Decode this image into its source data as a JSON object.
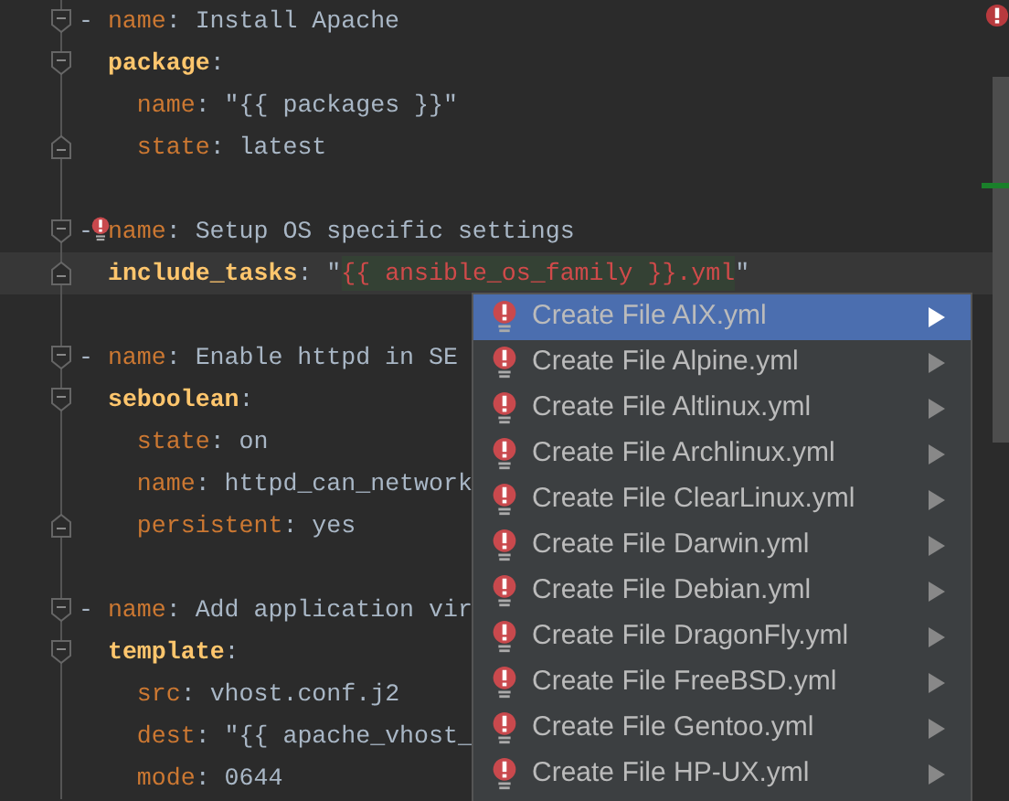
{
  "editor": {
    "lines": [
      {
        "kind": "code",
        "fold_start": true,
        "fold_end": false,
        "error": false,
        "current": false,
        "tokens": [
          {
            "text": "-",
            "kind": "dash"
          },
          {
            "text": "name",
            "kind": "key"
          },
          {
            "text": ":",
            "kind": "colon"
          },
          {
            "text": "Install Apache",
            "kind": "value"
          }
        ]
      },
      {
        "kind": "code",
        "fold_start": true,
        "fold_end": false,
        "error": false,
        "current": false,
        "tokens": [
          {
            "text": "  package",
            "kind": "section"
          },
          {
            "text": ":",
            "kind": "colon"
          }
        ]
      },
      {
        "kind": "code",
        "fold_start": false,
        "fold_end": false,
        "error": false,
        "current": false,
        "tokens": [
          {
            "text": "    name",
            "kind": "key"
          },
          {
            "text": ":",
            "kind": "colon"
          },
          {
            "text": "\"{{ packages }}\"",
            "kind": "value"
          }
        ]
      },
      {
        "kind": "code",
        "fold_start": false,
        "fold_end": true,
        "error": false,
        "current": false,
        "tokens": [
          {
            "text": "    state",
            "kind": "key"
          },
          {
            "text": ":",
            "kind": "colon"
          },
          {
            "text": "latest",
            "kind": "value"
          }
        ]
      },
      {
        "kind": "blank"
      },
      {
        "kind": "code",
        "fold_start": true,
        "fold_end": false,
        "error": true,
        "current": false,
        "tokens": [
          {
            "text": "-",
            "kind": "dash"
          },
          {
            "text": "name",
            "kind": "key"
          },
          {
            "text": ":",
            "kind": "colon"
          },
          {
            "text": "Setup OS specific settings",
            "kind": "value"
          }
        ]
      },
      {
        "kind": "code",
        "fold_start": false,
        "fold_end": true,
        "error": false,
        "current": true,
        "tokens": [
          {
            "text": "  include_tasks",
            "kind": "section"
          },
          {
            "text": ":",
            "kind": "colon"
          },
          {
            "text": "\"",
            "kind": "quote"
          },
          {
            "text": "{{ ansible_os_family }}.yml",
            "kind": "error"
          },
          {
            "text": "\"",
            "kind": "quote"
          }
        ]
      },
      {
        "kind": "blank"
      },
      {
        "kind": "code",
        "fold_start": true,
        "fold_end": false,
        "error": false,
        "current": false,
        "tokens": [
          {
            "text": "-",
            "kind": "dash"
          },
          {
            "text": "name",
            "kind": "key"
          },
          {
            "text": ":",
            "kind": "colon"
          },
          {
            "text": "Enable httpd in SE",
            "kind": "value"
          }
        ]
      },
      {
        "kind": "code",
        "fold_start": true,
        "fold_end": false,
        "error": false,
        "current": false,
        "tokens": [
          {
            "text": "  seboolean",
            "kind": "section"
          },
          {
            "text": ":",
            "kind": "colon"
          }
        ]
      },
      {
        "kind": "code",
        "fold_start": false,
        "fold_end": false,
        "error": false,
        "current": false,
        "tokens": [
          {
            "text": "    state",
            "kind": "key"
          },
          {
            "text": ":",
            "kind": "colon"
          },
          {
            "text": "on",
            "kind": "value"
          }
        ]
      },
      {
        "kind": "code",
        "fold_start": false,
        "fold_end": false,
        "error": false,
        "current": false,
        "tokens": [
          {
            "text": "    name",
            "kind": "key"
          },
          {
            "text": ":",
            "kind": "colon"
          },
          {
            "text": "httpd_can_network",
            "kind": "value"
          }
        ]
      },
      {
        "kind": "code",
        "fold_start": false,
        "fold_end": true,
        "error": false,
        "current": false,
        "tokens": [
          {
            "text": "    persistent",
            "kind": "key"
          },
          {
            "text": ":",
            "kind": "colon"
          },
          {
            "text": "yes",
            "kind": "value"
          }
        ]
      },
      {
        "kind": "blank"
      },
      {
        "kind": "code",
        "fold_start": true,
        "fold_end": false,
        "error": false,
        "current": false,
        "tokens": [
          {
            "text": "-",
            "kind": "dash"
          },
          {
            "text": "name",
            "kind": "key"
          },
          {
            "text": ":",
            "kind": "colon"
          },
          {
            "text": "Add application vir",
            "kind": "value"
          }
        ]
      },
      {
        "kind": "code",
        "fold_start": true,
        "fold_end": false,
        "error": false,
        "current": false,
        "tokens": [
          {
            "text": "  template",
            "kind": "section"
          },
          {
            "text": ":",
            "kind": "colon"
          }
        ]
      },
      {
        "kind": "code",
        "fold_start": false,
        "fold_end": false,
        "error": false,
        "current": false,
        "tokens": [
          {
            "text": "    src",
            "kind": "key"
          },
          {
            "text": ":",
            "kind": "colon"
          },
          {
            "text": "vhost.conf.j2",
            "kind": "value"
          }
        ]
      },
      {
        "kind": "code",
        "fold_start": false,
        "fold_end": false,
        "error": false,
        "current": false,
        "tokens": [
          {
            "text": "    dest",
            "kind": "key"
          },
          {
            "text": ":",
            "kind": "colon"
          },
          {
            "text": "\"{{ apache_vhost_",
            "kind": "value"
          }
        ]
      },
      {
        "kind": "code",
        "fold_start": false,
        "fold_end": false,
        "error": false,
        "current": false,
        "tokens": [
          {
            "text": "    mode",
            "kind": "key"
          },
          {
            "text": ":",
            "kind": "colon"
          },
          {
            "text": "0644",
            "kind": "value"
          }
        ]
      }
    ]
  },
  "popup": {
    "items": [
      {
        "label": "Create File AIX.yml",
        "selected": true
      },
      {
        "label": "Create File Alpine.yml",
        "selected": false
      },
      {
        "label": "Create File Altlinux.yml",
        "selected": false
      },
      {
        "label": "Create File Archlinux.yml",
        "selected": false
      },
      {
        "label": "Create File ClearLinux.yml",
        "selected": false
      },
      {
        "label": "Create File Darwin.yml",
        "selected": false
      },
      {
        "label": "Create File Debian.yml",
        "selected": false
      },
      {
        "label": "Create File DragonFly.yml",
        "selected": false
      },
      {
        "label": "Create File FreeBSD.yml",
        "selected": false
      },
      {
        "label": "Create File Gentoo.yml",
        "selected": false
      },
      {
        "label": "Create File HP-UX.yml",
        "selected": false
      }
    ]
  }
}
